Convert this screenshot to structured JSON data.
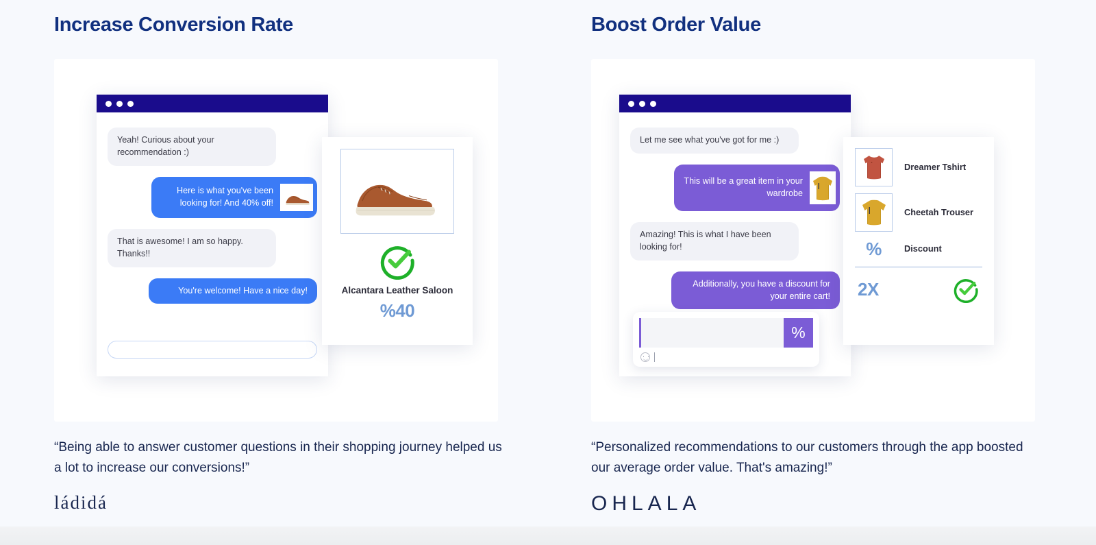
{
  "background_color": "#f7f9fd",
  "columns": [
    {
      "id": "increase-conversion-rate",
      "title": "Increase Conversion Rate",
      "accent_color": "#3b7bf6",
      "titlebar_color": "#1a0c8c",
      "chat": {
        "messages": [
          {
            "from": "customer",
            "text": "Yeah! Curious about your recommendation :)"
          },
          {
            "from": "agent",
            "text": "Here is  what you've been looking for! And 40% off!",
            "thumbnail": "brown-sneaker-thumbnail"
          },
          {
            "from": "customer",
            "text": "That is awesome! I am so happy. Thanks!!"
          },
          {
            "from": "agent",
            "text": "You're welcome! Have a nice day!"
          }
        ],
        "input_placeholder": ""
      },
      "product": {
        "image": "brown-leather-sneaker",
        "status_icon": "green-check-circle-icon",
        "name": "Alcantara Leather Saloon",
        "discount": "%40"
      },
      "quote": "“Being able to answer customer questions in their shopping journey helped us a lot to increase our conversions!”",
      "brand": "ládidá"
    },
    {
      "id": "boost-order-value",
      "title": "Boost Order Value",
      "accent_color": "#7b5cd6",
      "titlebar_color": "#1a0c8c",
      "chat": {
        "messages": [
          {
            "from": "customer",
            "text": "Let me see what you've got for me :)"
          },
          {
            "from": "agent",
            "text": "This will be a great item in your wardrobe",
            "thumbnail": "mustard-sweater-thumbnail"
          },
          {
            "from": "customer",
            "text": "Amazing! This is what I have been looking for!"
          },
          {
            "from": "agent",
            "text": "Additionally, you have a discount for your entire cart!"
          }
        ],
        "composer": {
          "badge": "%",
          "emoji_icon": "smiley-face-icon"
        }
      },
      "product_list": {
        "items": [
          {
            "image": "red-tank-top",
            "label": "Dreamer Tshirt"
          },
          {
            "image": "mustard-sweater",
            "label": "Cheetah Trouser"
          },
          {
            "image": "percent-symbol",
            "label": "Discount",
            "symbol": "%"
          }
        ],
        "multiplier": "2X",
        "status_icon": "green-check-circle-icon"
      },
      "quote": "“Personalized recommendations to our customers through the app boosted our average order value. That's amazing!”",
      "brand": "OHLALA"
    }
  ]
}
